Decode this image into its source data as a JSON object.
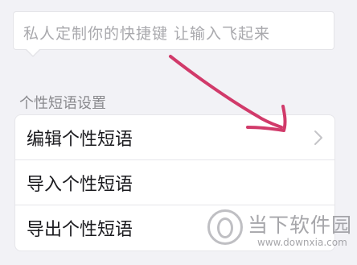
{
  "tip": {
    "text": "私人定制你的快捷键 让输入飞起来"
  },
  "section": {
    "title": "个性短语设置"
  },
  "items": [
    {
      "label": "编辑个性短语",
      "icon": "chevron-right-icon"
    },
    {
      "label": "导入个性短语"
    },
    {
      "label": "导出个性短语"
    }
  ],
  "watermark": {
    "name": "当下软件园",
    "url": "www.downxia.com"
  },
  "colors": {
    "annotation": "#d13a6a",
    "chevron": "#c4c4c8"
  }
}
